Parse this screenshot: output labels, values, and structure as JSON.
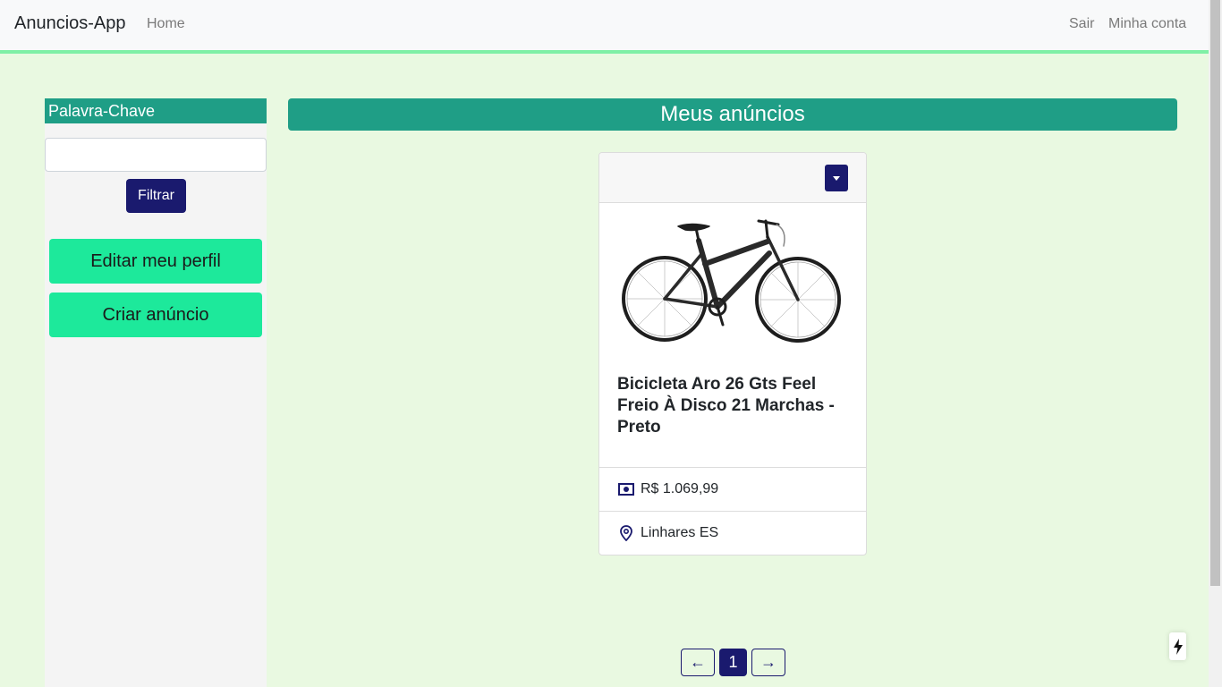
{
  "navbar": {
    "brand": "Anuncios-App",
    "home": "Home",
    "logout": "Sair",
    "account": "Minha conta"
  },
  "sidebar": {
    "keyword_label": "Palavra-Chave",
    "keyword_value": "",
    "filter_label": "Filtrar",
    "edit_profile_label": "Editar meu perfil",
    "create_ad_label": "Criar anúncio"
  },
  "main": {
    "title": "Meus anúncios",
    "ads": [
      {
        "title": "Bicicleta Aro 26 Gts Feel Freio À Disco 21 Marchas - Preto",
        "price": "R$ 1.069,99",
        "location": "Linhares ES",
        "image_icon": "bicycle-image"
      }
    ]
  },
  "pagination": {
    "prev": "←",
    "current": "1",
    "next": "→"
  },
  "colors": {
    "page_bg": "#e9f9e1",
    "accent_teal": "#1f9e86",
    "navy": "#1a1a6e",
    "mint": "#1de99b",
    "nav_border": "#7ff0a6"
  },
  "icons": {
    "dropdown": "caret-down-icon",
    "price": "money-icon",
    "location": "location-pin-icon",
    "floating": "lightning-icon"
  }
}
